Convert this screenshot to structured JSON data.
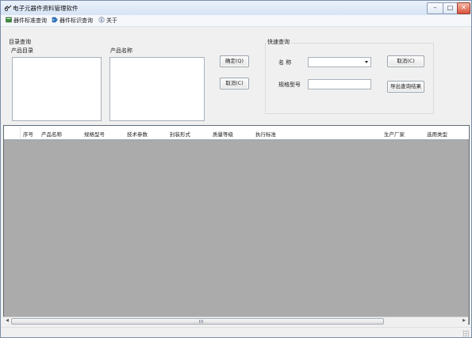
{
  "window": {
    "title": "电子元器件资料管理软件",
    "minimize": "–",
    "maximize": "□",
    "close": "✕"
  },
  "menu": [
    {
      "label": "器件标准查询",
      "icon": "book-icon"
    },
    {
      "label": "器件标识查询",
      "icon": "tag-icon"
    },
    {
      "label": "关于",
      "icon": "info-icon"
    }
  ],
  "catalog_group": {
    "title": "目录查询",
    "catalog_label": "产品目录",
    "product_label": "产品名称",
    "confirm_button": "确定(Q)",
    "cancel_button": "取消(C)"
  },
  "quick_group": {
    "title": "快速查询",
    "name_label": "名 称",
    "model_label": "规格型号",
    "name_value": "",
    "model_value": "",
    "cancel_button": "取消(C)",
    "export_button": "导出查询结果"
  },
  "grid": {
    "columns": [
      "序号",
      "产品名称",
      "规格型号",
      "技术参数",
      "封装形式",
      "质量等级",
      "执行标准",
      "生产厂家",
      "选用类型"
    ]
  },
  "colors": {
    "grid_background": "#ababab",
    "window_background": "#f0f0f0",
    "titlebar": "#dce7f5"
  }
}
